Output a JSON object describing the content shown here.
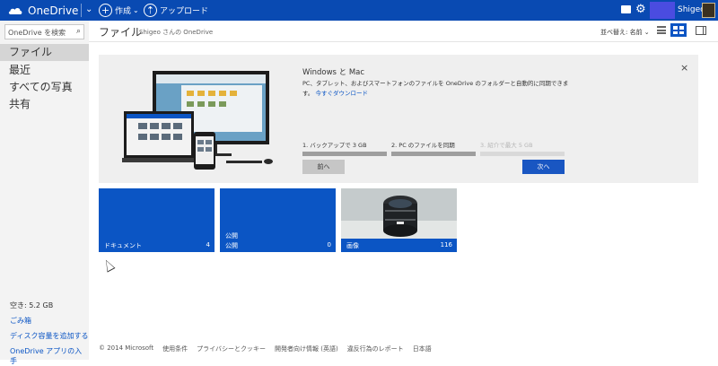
{
  "app": {
    "brand": "OneDrive"
  },
  "topbar": {
    "create_label": "作成",
    "upload_label": "アップロード",
    "user_name": "Shigeo",
    "colors": {
      "bar": "#094ab2",
      "user_block": "#4a4ce0"
    }
  },
  "sidebar": {
    "search_placeholder": "OneDrive を検索",
    "items": [
      {
        "label": "ファイル",
        "active": true
      },
      {
        "label": "最近",
        "active": false
      },
      {
        "label": "すべての写真",
        "active": false
      },
      {
        "label": "共有",
        "active": false
      }
    ],
    "storage": "空き: 5.2 GB",
    "recycle": "ごみ箱",
    "add_storage": "ディスク容量を追加する",
    "get_apps": "OneDrive アプリの入手"
  },
  "breadcrumb": {
    "title": "ファイル",
    "owner": "Shigeo さんの OneDrive",
    "sort": "並べ替え: 名前 ⌄"
  },
  "promo": {
    "title": "Windows と Mac",
    "text": "PC、タブレット、およびスマートフォンのファイルを OneDrive のフォルダーと自動的に同期できます。",
    "download_link": "今すぐダウンロード",
    "steps": [
      {
        "label": "1. バックアップで 3 GB",
        "done": true
      },
      {
        "label": "2. PC のファイルを同期",
        "done": true
      },
      {
        "label": "3. 紹介で最大 5 GB",
        "done": false
      }
    ],
    "prev_label": "前へ",
    "next_label": "次へ",
    "close": "×"
  },
  "tiles": [
    {
      "name": "ドキュメント",
      "count": "4",
      "sub": ""
    },
    {
      "name": "公開",
      "count": "0",
      "sub": "公開"
    },
    {
      "name": "画像",
      "count": "116",
      "sub": ""
    }
  ],
  "footer": [
    "© 2014 Microsoft",
    "使用条件",
    "プライバシーとクッキー",
    "開発者向け情報 (英語)",
    "違反行為のレポート",
    "日本語"
  ]
}
